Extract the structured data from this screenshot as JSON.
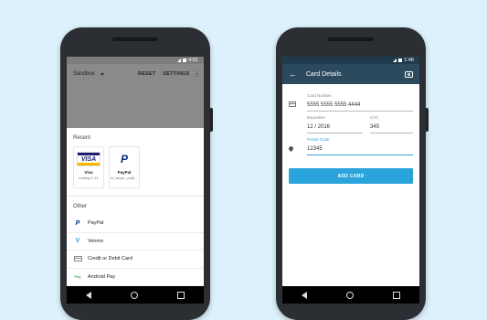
{
  "colors": {
    "background": "#dcf1fb",
    "accent": "#2ba4dc",
    "toolbar_dark": "#2c4a5e",
    "toolbar_gray": "#8a8a8a"
  },
  "left_phone": {
    "status_time": "4:51",
    "toolbar": {
      "title": "Sandbox",
      "reset": "RESET",
      "settings": "SETTINGS"
    },
    "recent": {
      "heading": "Recent",
      "items": [
        {
          "icon": "visa-logo",
          "logo_text": "VISA",
          "name": "Visa",
          "detail": "ending in 11"
        },
        {
          "icon": "paypal-logo",
          "logo_text": "P",
          "name": "PayPal",
          "detail": "bt_buyer_us@..."
        }
      ]
    },
    "other": {
      "heading": "Other",
      "items": [
        {
          "icon": "paypal-icon",
          "glyph": "P",
          "label": "PayPal"
        },
        {
          "icon": "venmo-icon",
          "glyph": "V",
          "label": "Venmo"
        },
        {
          "icon": "credit-card-icon",
          "glyph": "",
          "label": "Credit or Debit Card"
        },
        {
          "icon": "android-pay-icon",
          "glyph": "Pay",
          "label": "Android Pay"
        }
      ]
    }
  },
  "right_phone": {
    "status_time": "1:46",
    "toolbar": {
      "back_glyph": "←",
      "title": "Card Details"
    },
    "form": {
      "card_number_label": "Card Number",
      "card_number_value": "5555 5555 5555 4444",
      "expiration_label": "Expiration",
      "expiration_value": "12 / 2016",
      "cvc_label": "CVC",
      "cvc_value": "345",
      "postal_label": "Postal Code",
      "postal_value": "12345",
      "submit_label": "ADD CARD"
    }
  }
}
